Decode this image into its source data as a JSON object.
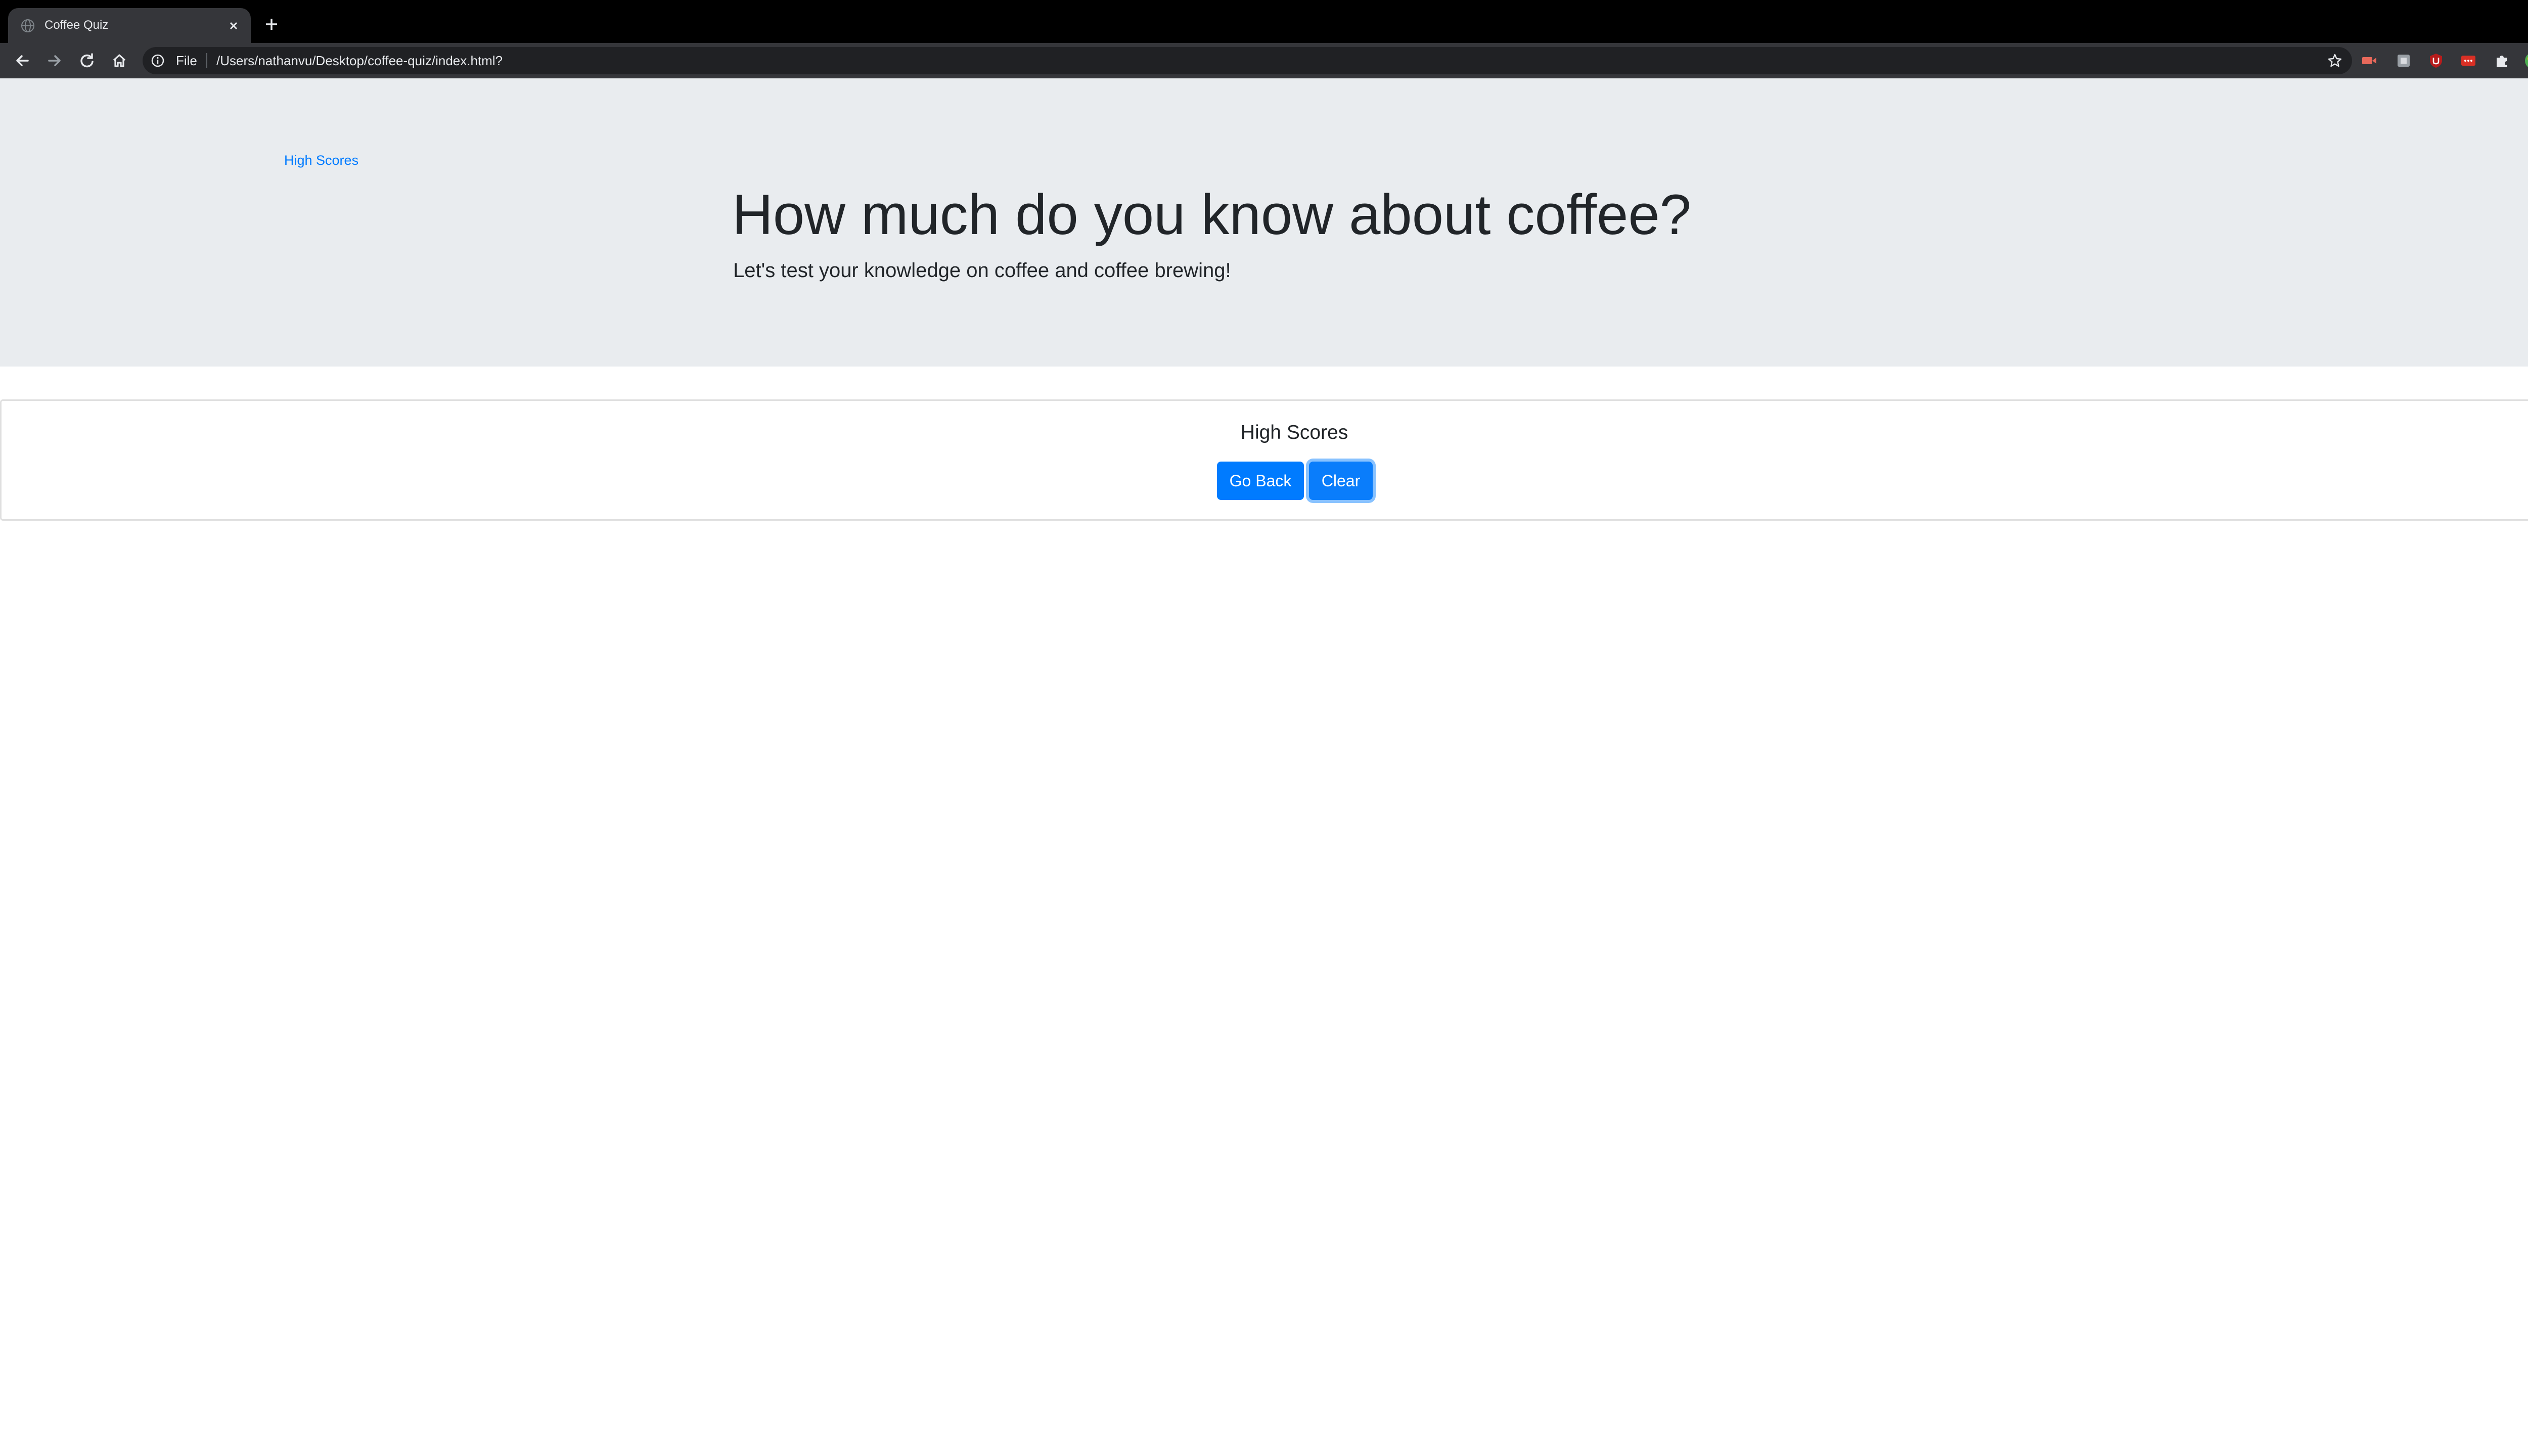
{
  "browser": {
    "tab": {
      "title": "Coffee Quiz",
      "favicon": "globe-icon",
      "close": "close-icon"
    },
    "new_tab": "plus-icon",
    "nav": [
      "back-arrow-icon",
      "forward-arrow-icon",
      "reload-icon",
      "home-icon"
    ],
    "address_bar": {
      "security_icon": "info-icon",
      "scheme_label": "File",
      "url": "/Users/nathanvu/Desktop/coffee-quiz/index.html?",
      "bookmark_icon": "star-icon"
    },
    "extensions": [
      "video-extension-icon",
      "gray-extension-icon",
      "ublock-shield-icon",
      "red-extension-icon",
      "puzzle-icon",
      "avatar-icon",
      "kebab-menu-icon"
    ],
    "colors": {
      "tabstrip": "#000000",
      "toolbar": "#35363a",
      "omnibox": "#202124"
    }
  },
  "page": {
    "high_scores_link": "High Scores",
    "title": "How much do you know about coffee?",
    "lead": "Let's test your knowledge on coffee and coffee brewing!",
    "card": {
      "title": "High Scores",
      "go_back_label": "Go Back",
      "clear_label": "Clear"
    },
    "colors": {
      "jumbotron_bg": "#e9ecef",
      "primary": "#007bff",
      "text": "#212529"
    }
  }
}
